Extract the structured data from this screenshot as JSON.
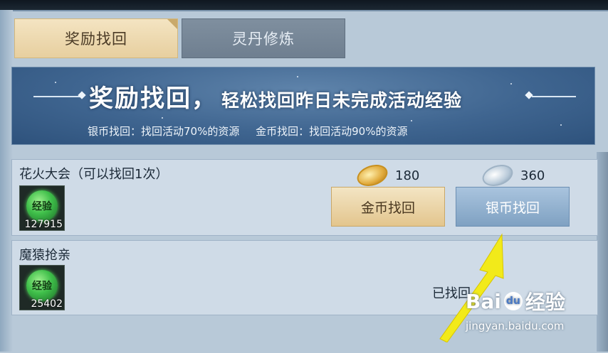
{
  "tabs": [
    {
      "label": "奖励找回",
      "active": true
    },
    {
      "label": "灵丹修炼",
      "active": false
    }
  ],
  "banner": {
    "title": "奖励找回，",
    "subtitle": "轻松找回昨日未完成活动经验",
    "desc_silver": "银币找回：找回活动70%的资源",
    "desc_gold": "金币找回：找回活动90%的资源"
  },
  "rows": [
    {
      "title": "花火大会（可以找回1次）",
      "icon_text": "经验",
      "exp": "127915",
      "gold_cost": "180",
      "silver_cost": "360",
      "gold_button": "金币找回",
      "silver_button": "银币找回"
    },
    {
      "title": "魔猿抢亲",
      "icon_text": "经验",
      "exp": "25402",
      "status": "已找回"
    }
  ],
  "watermark": {
    "logo": "Bai",
    "logo_paw": "du",
    "logo_suffix": "经验",
    "url": "jingyan.baidu.com"
  },
  "colors": {
    "panel": "#b8c9d8",
    "banner": "#3f6590",
    "gold_button": "#e3c58d",
    "silver_button": "#7fa1c2",
    "arrow": "#f2ea1a"
  }
}
